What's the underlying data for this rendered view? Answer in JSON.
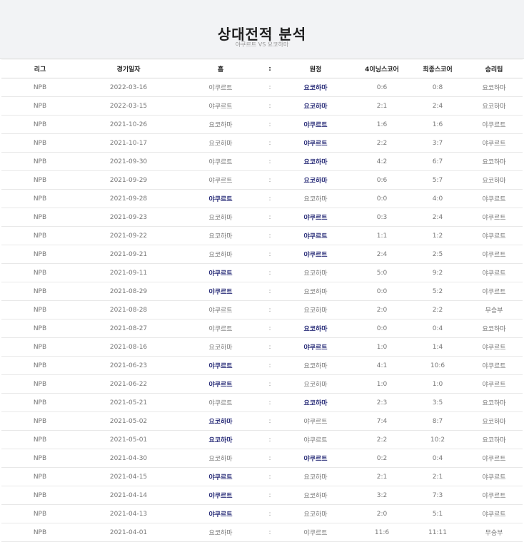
{
  "header": {
    "title": "상대전적 분석",
    "subtitle": "야쿠르트 VS 요코하마"
  },
  "columns": [
    "리그",
    "경기일자",
    "홈",
    ":",
    "원정",
    "4이닝스코어",
    "최종스코어",
    "승리팀"
  ],
  "accent_color": "#2b2f7a",
  "rows": [
    {
      "league": "NPB",
      "date": "2022-03-16",
      "home": "야쿠르트",
      "sep": ":",
      "away": "요코하마",
      "score4": "0:6",
      "final": "0:8",
      "winner": "요코하마",
      "bold": "away"
    },
    {
      "league": "NPB",
      "date": "2022-03-15",
      "home": "야쿠르트",
      "sep": ":",
      "away": "요코하마",
      "score4": "2:1",
      "final": "2:4",
      "winner": "요코하마",
      "bold": "away"
    },
    {
      "league": "NPB",
      "date": "2021-10-26",
      "home": "요코하마",
      "sep": ":",
      "away": "야쿠르트",
      "score4": "1:6",
      "final": "1:6",
      "winner": "야쿠르트",
      "bold": "away"
    },
    {
      "league": "NPB",
      "date": "2021-10-17",
      "home": "요코하마",
      "sep": ":",
      "away": "야쿠르트",
      "score4": "2:2",
      "final": "3:7",
      "winner": "야쿠르트",
      "bold": "away"
    },
    {
      "league": "NPB",
      "date": "2021-09-30",
      "home": "야쿠르트",
      "sep": ":",
      "away": "요코하마",
      "score4": "4:2",
      "final": "6:7",
      "winner": "요코하마",
      "bold": "away"
    },
    {
      "league": "NPB",
      "date": "2021-09-29",
      "home": "야쿠르트",
      "sep": ":",
      "away": "요코하마",
      "score4": "0:6",
      "final": "5:7",
      "winner": "요코하마",
      "bold": "away"
    },
    {
      "league": "NPB",
      "date": "2021-09-28",
      "home": "야쿠르트",
      "sep": ":",
      "away": "요코하마",
      "score4": "0:0",
      "final": "4:0",
      "winner": "야쿠르트",
      "bold": "home"
    },
    {
      "league": "NPB",
      "date": "2021-09-23",
      "home": "요코하마",
      "sep": ":",
      "away": "야쿠르트",
      "score4": "0:3",
      "final": "2:4",
      "winner": "야쿠르트",
      "bold": "away"
    },
    {
      "league": "NPB",
      "date": "2021-09-22",
      "home": "요코하마",
      "sep": ":",
      "away": "야쿠르트",
      "score4": "1:1",
      "final": "1:2",
      "winner": "야쿠르트",
      "bold": "away"
    },
    {
      "league": "NPB",
      "date": "2021-09-21",
      "home": "요코하마",
      "sep": ":",
      "away": "야쿠르트",
      "score4": "2:4",
      "final": "2:5",
      "winner": "야쿠르트",
      "bold": "away"
    },
    {
      "league": "NPB",
      "date": "2021-09-11",
      "home": "야쿠르트",
      "sep": ":",
      "away": "요코하마",
      "score4": "5:0",
      "final": "9:2",
      "winner": "야쿠르트",
      "bold": "home"
    },
    {
      "league": "NPB",
      "date": "2021-08-29",
      "home": "야쿠르트",
      "sep": ":",
      "away": "요코하마",
      "score4": "0:0",
      "final": "5:2",
      "winner": "야쿠르트",
      "bold": "home"
    },
    {
      "league": "NPB",
      "date": "2021-08-28",
      "home": "야쿠르트",
      "sep": ":",
      "away": "요코하마",
      "score4": "2:0",
      "final": "2:2",
      "winner": "무승부",
      "bold": "none"
    },
    {
      "league": "NPB",
      "date": "2021-08-27",
      "home": "야쿠르트",
      "sep": ":",
      "away": "요코하마",
      "score4": "0:0",
      "final": "0:4",
      "winner": "요코하마",
      "bold": "away"
    },
    {
      "league": "NPB",
      "date": "2021-08-16",
      "home": "요코하마",
      "sep": ":",
      "away": "야쿠르트",
      "score4": "1:0",
      "final": "1:4",
      "winner": "야쿠르트",
      "bold": "away"
    },
    {
      "league": "NPB",
      "date": "2021-06-23",
      "home": "야쿠르트",
      "sep": ":",
      "away": "요코하마",
      "score4": "4:1",
      "final": "10:6",
      "winner": "야쿠르트",
      "bold": "home"
    },
    {
      "league": "NPB",
      "date": "2021-06-22",
      "home": "야쿠르트",
      "sep": ":",
      "away": "요코하마",
      "score4": "1:0",
      "final": "1:0",
      "winner": "야쿠르트",
      "bold": "home"
    },
    {
      "league": "NPB",
      "date": "2021-05-21",
      "home": "야쿠르트",
      "sep": ":",
      "away": "요코하마",
      "score4": "2:3",
      "final": "3:5",
      "winner": "요코하마",
      "bold": "away"
    },
    {
      "league": "NPB",
      "date": "2021-05-02",
      "home": "요코하마",
      "sep": ":",
      "away": "야쿠르트",
      "score4": "7:4",
      "final": "8:7",
      "winner": "요코하마",
      "bold": "home"
    },
    {
      "league": "NPB",
      "date": "2021-05-01",
      "home": "요코하마",
      "sep": ":",
      "away": "야쿠르트",
      "score4": "2:2",
      "final": "10:2",
      "winner": "요코하마",
      "bold": "home"
    },
    {
      "league": "NPB",
      "date": "2021-04-30",
      "home": "요코하마",
      "sep": ":",
      "away": "야쿠르트",
      "score4": "0:2",
      "final": "0:4",
      "winner": "야쿠르트",
      "bold": "away"
    },
    {
      "league": "NPB",
      "date": "2021-04-15",
      "home": "야쿠르트",
      "sep": ":",
      "away": "요코하마",
      "score4": "2:1",
      "final": "2:1",
      "winner": "야쿠르트",
      "bold": "home"
    },
    {
      "league": "NPB",
      "date": "2021-04-14",
      "home": "야쿠르트",
      "sep": ":",
      "away": "요코하마",
      "score4": "3:2",
      "final": "7:3",
      "winner": "야쿠르트",
      "bold": "home"
    },
    {
      "league": "NPB",
      "date": "2021-04-13",
      "home": "야쿠르트",
      "sep": ":",
      "away": "요코하마",
      "score4": "2:0",
      "final": "5:1",
      "winner": "야쿠르트",
      "bold": "home"
    },
    {
      "league": "NPB",
      "date": "2021-04-01",
      "home": "요코하마",
      "sep": ":",
      "away": "야쿠르트",
      "score4": "11:6",
      "final": "11:11",
      "winner": "무승부",
      "bold": "none"
    }
  ]
}
